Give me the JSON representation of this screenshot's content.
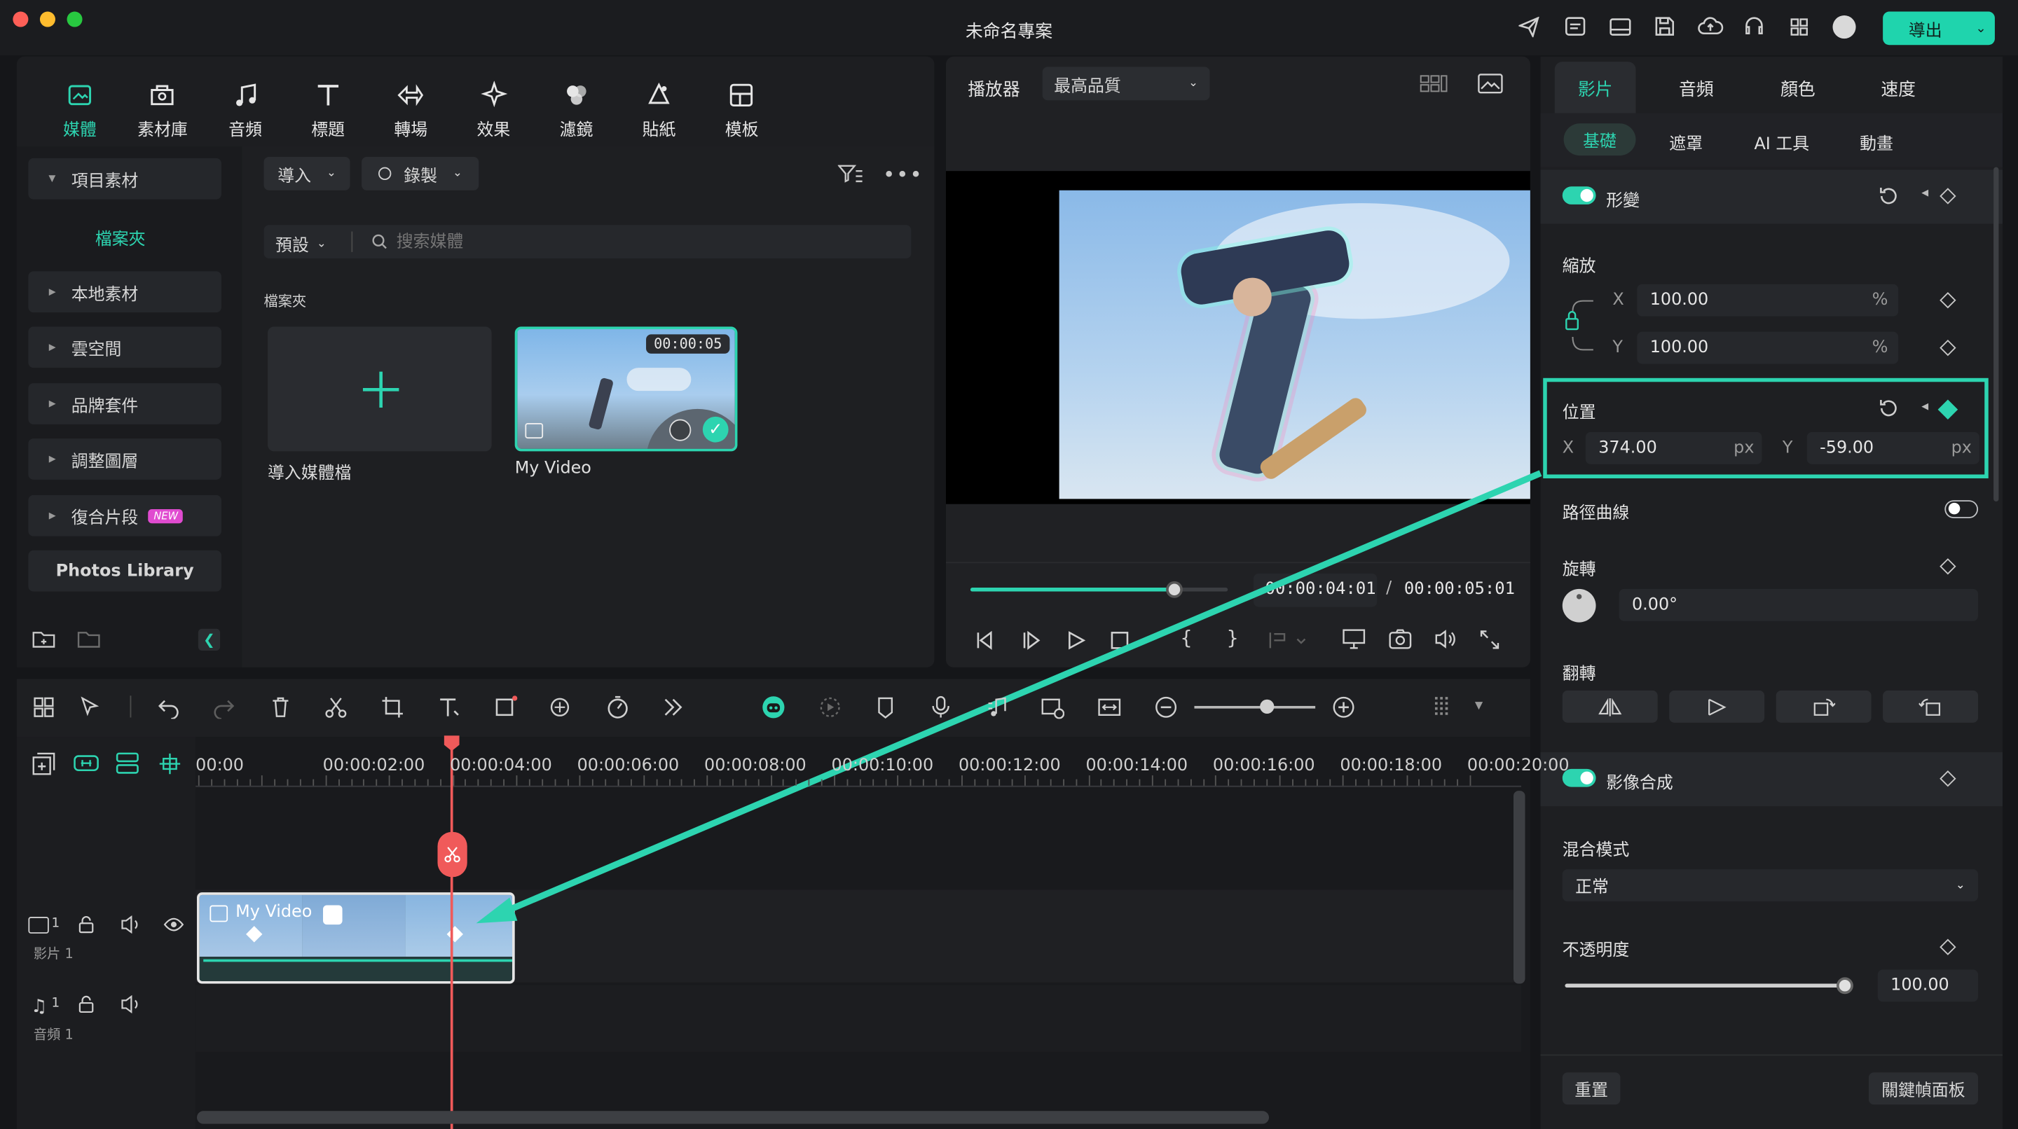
{
  "window": {
    "title": "未命名專案",
    "export_label": "導出"
  },
  "media_nav": {
    "items": [
      {
        "label": "媒體",
        "icon": "media-icon"
      },
      {
        "label": "素材庫",
        "icon": "stock-library-icon"
      },
      {
        "label": "音頻",
        "icon": "music-note-icon"
      },
      {
        "label": "標題",
        "icon": "title-t-icon"
      },
      {
        "label": "轉場",
        "icon": "transition-icon"
      },
      {
        "label": "效果",
        "icon": "effects-icon"
      },
      {
        "label": "濾鏡",
        "icon": "filters-icon"
      },
      {
        "label": "貼紙",
        "icon": "sticker-icon"
      },
      {
        "label": "模板",
        "icon": "template-icon"
      }
    ]
  },
  "sidebar": {
    "project_media": "項目素材",
    "folder": "檔案夾",
    "local": "本地素材",
    "cloud": "雲空間",
    "brand": "品牌套件",
    "adjust": "調整圖層",
    "compound": "復合片段",
    "new_badge": "NEW",
    "photos": "Photos Library"
  },
  "media": {
    "import_label": "導入",
    "record_label": "錄製",
    "preset_label": "預設",
    "search_placeholder": "搜索媒體",
    "folder_heading": "檔案夾",
    "import_tile_label": "導入媒體檔",
    "clip_name": "My Video",
    "clip_duration": "00:00:05"
  },
  "player": {
    "label": "播放器",
    "quality": "最高品質",
    "current_time": "00:00:04:01",
    "separator": "/",
    "total_time": "00:00:05:01",
    "progress": 0.79
  },
  "inspector": {
    "tabs": [
      "影片",
      "音頻",
      "顏色",
      "速度"
    ],
    "subtabs": [
      "基礎",
      "遮罩",
      "AI 工具",
      "動畫"
    ],
    "transform": "形變",
    "scale": "縮放",
    "scale_x": "100.00",
    "scale_y": "100.00",
    "percent": "%",
    "position": "位置",
    "pos_x": "374.00",
    "pos_y": "-59.00",
    "px": "px",
    "x": "X",
    "y": "Y",
    "path_curve": "路徑曲線",
    "rotation": "旋轉",
    "rotation_value": "0.00°",
    "flip": "翻轉",
    "compositing": "影像合成",
    "blend_mode": "混合模式",
    "blend_value": "正常",
    "opacity": "不透明度",
    "opacity_value": "100.00",
    "reset": "重置",
    "keyframe_panel": "關鍵幀面板"
  },
  "timeline": {
    "times": [
      "00:00",
      "00:00:02:00",
      "00:00:04:00",
      "00:00:06:00",
      "00:00:08:00",
      "00:00:10:00",
      "00:00:12:00",
      "00:00:14:00",
      "00:00:16:00",
      "00:00:18:00",
      "00:00:20:00"
    ],
    "video_track": "影片 1",
    "audio_track": "音頻 1",
    "track_num": "1",
    "clip_label": "My Video",
    "zoom_level": 0.6
  },
  "colors": {
    "accent": "#2dd4b0",
    "playhead": "#f05a5a",
    "export": "#1fd4ad"
  }
}
